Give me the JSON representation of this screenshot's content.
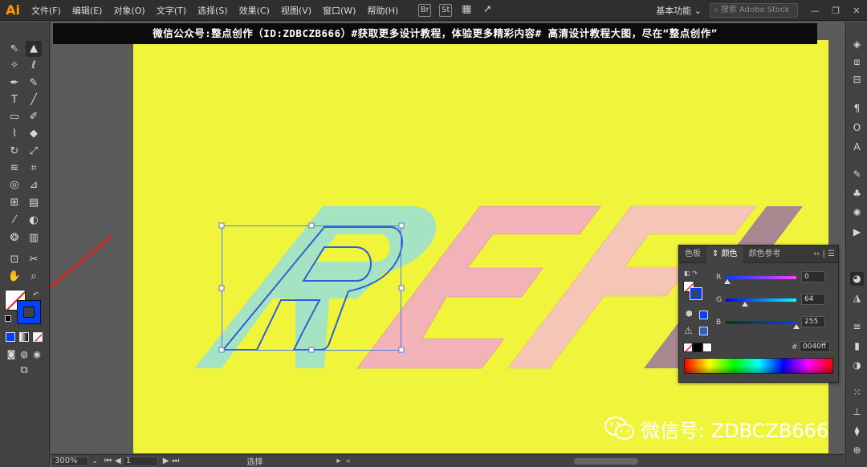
{
  "app": {
    "logo": "Ai"
  },
  "menu": [
    "文件(F)",
    "编辑(E)",
    "对象(O)",
    "文字(T)",
    "选择(S)",
    "效果(C)",
    "视图(V)",
    "窗口(W)",
    "帮助(H)"
  ],
  "menubar_icons": [
    "Br",
    "St"
  ],
  "workspace": "基本功能",
  "search_placeholder": "搜索 Adobe Stock",
  "banner": "微信公众号:整点创作（ID:ZDBCZB666）#获取更多设计教程，体验更多精彩内容# 高清设计教程大图，尽在“整点创作”",
  "canvas": {
    "letters": [
      "R",
      "E",
      "F",
      "L"
    ],
    "colors": {
      "artboard": "#f0f53c",
      "mint": "#a6e3c2",
      "pink": "#f2b3b8",
      "peach": "#f5c6b5",
      "mauve": "#a78891",
      "outline": "#2e5fd9"
    }
  },
  "color_panel": {
    "tabs": [
      "色板",
      "颜色",
      "颜色参考"
    ],
    "active_tab": "颜色",
    "channels": [
      {
        "label": "R",
        "value": "0"
      },
      {
        "label": "G",
        "value": "64"
      },
      {
        "label": "B",
        "value": "255"
      }
    ],
    "hex_label": "#",
    "hex": "0040ff",
    "current_color": "#0040ff"
  },
  "status": {
    "zoom": "300%",
    "artboard": "1",
    "tool": "选择"
  },
  "watermark": "微信号: ZDBCZB666",
  "annotation_color": "#d62424"
}
